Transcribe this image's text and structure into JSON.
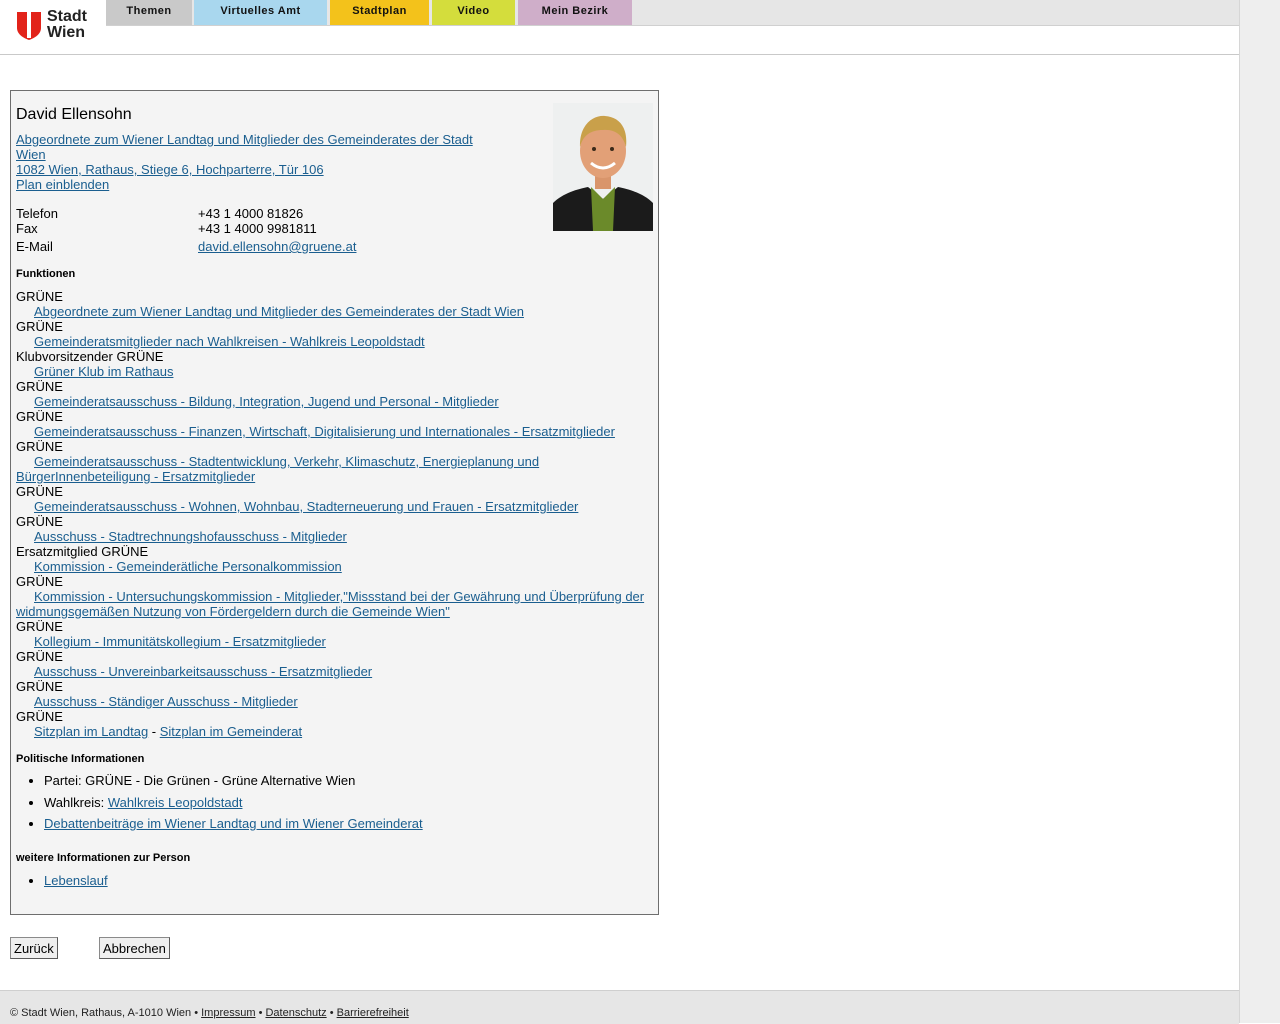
{
  "logo": {
    "line1": "Stadt",
    "line2": "Wien",
    "shield_color": "#e2231a"
  },
  "nav": {
    "tabs": [
      {
        "label": "Themen",
        "color": "#c9c9c9"
      },
      {
        "label": "Virtuelles Amt",
        "color": "#a9d7ee"
      },
      {
        "label": "Stadtplan",
        "color": "#f3c21b"
      },
      {
        "label": "Video",
        "color": "#d4dd3c"
      },
      {
        "label": "Mein Bezirk",
        "color": "#cfaec9"
      }
    ]
  },
  "person": {
    "name": "David Ellensohn",
    "role_link_line1": "Abgeordnete zum Wiener Landtag und Mitglieder des Gemeinderates der Stadt",
    "role_link_line2": "Wien ",
    "address_link": "1082 Wien, Rathaus, Stiege 6, Hochparterre, Tür 106",
    "map_link": "Plan einblenden",
    "phone_label": "Telefon",
    "phone": "+43 1 4000 81826",
    "fax_label": "Fax",
    "fax": "+43 1 4000 9981811",
    "email_label": "E-Mail",
    "email": "david.ellensohn@gruene.at"
  },
  "functions": {
    "title": "Funktionen",
    "items": [
      {
        "party": "GRÜNE",
        "link": "Abgeordnete zum Wiener Landtag und Mitglieder des Gemeinderates der Stadt Wien"
      },
      {
        "party": "GRÜNE",
        "link": "Gemeinderatsmitglieder nach Wahlkreisen - Wahlkreis Leopoldstadt"
      },
      {
        "party": "Klubvorsitzender GRÜNE",
        "link": "Grüner Klub im Rathaus"
      },
      {
        "party": "GRÜNE",
        "link": "Gemeinderatsausschuss - Bildung, Integration, Jugend und Personal - Mitglieder"
      },
      {
        "party": "GRÜNE",
        "link": "Gemeinderatsausschuss - Finanzen, Wirtschaft, Digitalisierung und Internationales - Ersatzmitglieder"
      },
      {
        "party": "GRÜNE",
        "link": "Gemeinderatsausschuss - Stadtentwicklung, Verkehr, Klimaschutz, Energieplanung und BürgerInnenbeteiligung - Ersatzmitglieder"
      },
      {
        "party": "GRÜNE",
        "link": "Gemeinderatsausschuss - Wohnen, Wohnbau, Stadterneuerung und Frauen - Ersatzmitglieder"
      },
      {
        "party": "GRÜNE",
        "link": "Ausschuss - Stadtrechnungshofausschuss - Mitglieder"
      },
      {
        "party": "Ersatzmitglied GRÜNE",
        "link": "Kommission - Gemeinderätliche Personalkommission"
      },
      {
        "party": "GRÜNE",
        "link": "Kommission - Untersuchungskommission - Mitglieder,\"Missstand bei der Gewährung und Überprüfung der widmungsgemäßen Nutzung von Fördergeldern durch die Gemeinde Wien\""
      },
      {
        "party": "GRÜNE",
        "link": "Kollegium - Immunitätskollegium - Ersatzmitglieder"
      },
      {
        "party": "GRÜNE",
        "link": "Ausschuss - Unvereinbarkeitsausschuss - Ersatzmitglieder"
      },
      {
        "party": "GRÜNE",
        "link": "Ausschuss - Ständiger Ausschuss - Mitglieder"
      }
    ],
    "last_party": "GRÜNE",
    "seat_landtag": "Sitzplan im Landtag",
    "seat_separator": " - ",
    "seat_gemeinderat": "Sitzplan im Gemeinderat"
  },
  "political": {
    "title": "Politische Informationen",
    "party_text": "Partei: GRÜNE - Die Grünen - Grüne Alternative Wien",
    "district_label": "Wahlkreis: ",
    "district_link": "Wahlkreis Leopoldstadt",
    "debates_link": "Debattenbeiträge im Wiener Landtag und im Wiener Gemeinderat"
  },
  "more": {
    "title": "weitere Informationen zur Person",
    "cv_link": "Lebenslauf"
  },
  "buttons": {
    "back": "Zurück",
    "cancel": "Abbrechen"
  },
  "footer": {
    "copyright": "© Stadt Wien, Rathaus, A-1010 Wien",
    "sep": " • ",
    "impressum": "Impressum",
    "datenschutz": "Datenschutz",
    "barrierefreiheit": "Barrierefreiheit"
  }
}
